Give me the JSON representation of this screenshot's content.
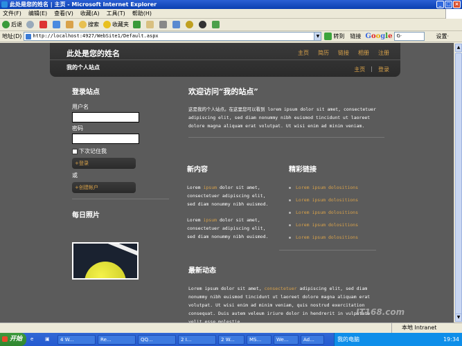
{
  "window": {
    "title": "此处是您的姓名 | 主页 - Microsoft Internet Explorer"
  },
  "menu": [
    "文件(F)",
    "编辑(E)",
    "查看(V)",
    "收藏(A)",
    "工具(T)",
    "帮助(H)"
  ],
  "toolbar": {
    "back": "后退",
    "search": "搜索",
    "favorites": "收藏夹"
  },
  "addressbar": {
    "label": "地址(D)",
    "url": "http://localhost:4927/WebSite1/Default.aspx",
    "go": "转到",
    "links": "链接",
    "google_search_value": "G·",
    "settings": "设置·"
  },
  "site": {
    "title": "此处是您的姓名",
    "subtitle": "我的个人站点",
    "top_nav": [
      "主页",
      "简历",
      "链接",
      "相册",
      "注册"
    ],
    "sub_nav": [
      "主页",
      "|",
      "登录"
    ],
    "login": {
      "heading": "登录站点",
      "username_label": "用户名",
      "password_label": "密码",
      "remember": "下次记住我",
      "login_button": "登录",
      "or": "或",
      "create_button": "创建帐户"
    },
    "photo_heading": "每日照片",
    "welcome": {
      "heading": "欢迎访问“我的站点”",
      "text": "这是我的个人站点。在这里您可以看到 lorem ipsum dolor sit amet, consectetuer adipiscing elit, sed diam nonummy nibh euismod tincidunt ut laoreet dolore magna aliquam erat volutpat. Ut wisi enim ad minim veniam."
    },
    "news": {
      "heading": "新内容",
      "items": [
        {
          "pre": "Lorem ",
          "acc": "ipsum",
          "post": " dolor sit amet, consectetuer adipiscing elit, sed diam nonummy nibh euismod."
        },
        {
          "pre": "Lorem ",
          "acc": "ipsum",
          "post": " dolor sit amet, consectetuer adipiscing elit, sed diam nonummy nibh euismod."
        }
      ]
    },
    "links": {
      "heading": "精彩链接",
      "items": [
        "Lorem ipsum dolositions",
        "Lorem ipsum dolositions",
        "Lorem ipsum dolositions",
        "Lorem ipsum dolositions",
        "Lorem ipsum dolositions"
      ]
    },
    "latest": {
      "heading": "最新动态",
      "pre": "Lorem ipsum dolor sit amet, ",
      "acc": "consectetuer",
      "post": " adipiscing elit, sed diam nonummy nibh euismod tincidunt ut laoreet dolore magna aliquam erat volutpat. Ut wisi enim ad minim veniam, quis nostrud exercitation consequat. Duis autem veleum iriure dolor in hendrerit in vulputate velit esse molestie"
    }
  },
  "status": {
    "zone": "本地 Intranet"
  },
  "taskbar": {
    "start": "开始",
    "tasks": [
      "4 W...",
      "Re...",
      "QQ...",
      "2 I...",
      "2 W...",
      "MS...",
      "We...",
      "Ad..."
    ],
    "tray_label": "我的电脑",
    "clock": "19:34"
  },
  "watermark": "IT168.com"
}
